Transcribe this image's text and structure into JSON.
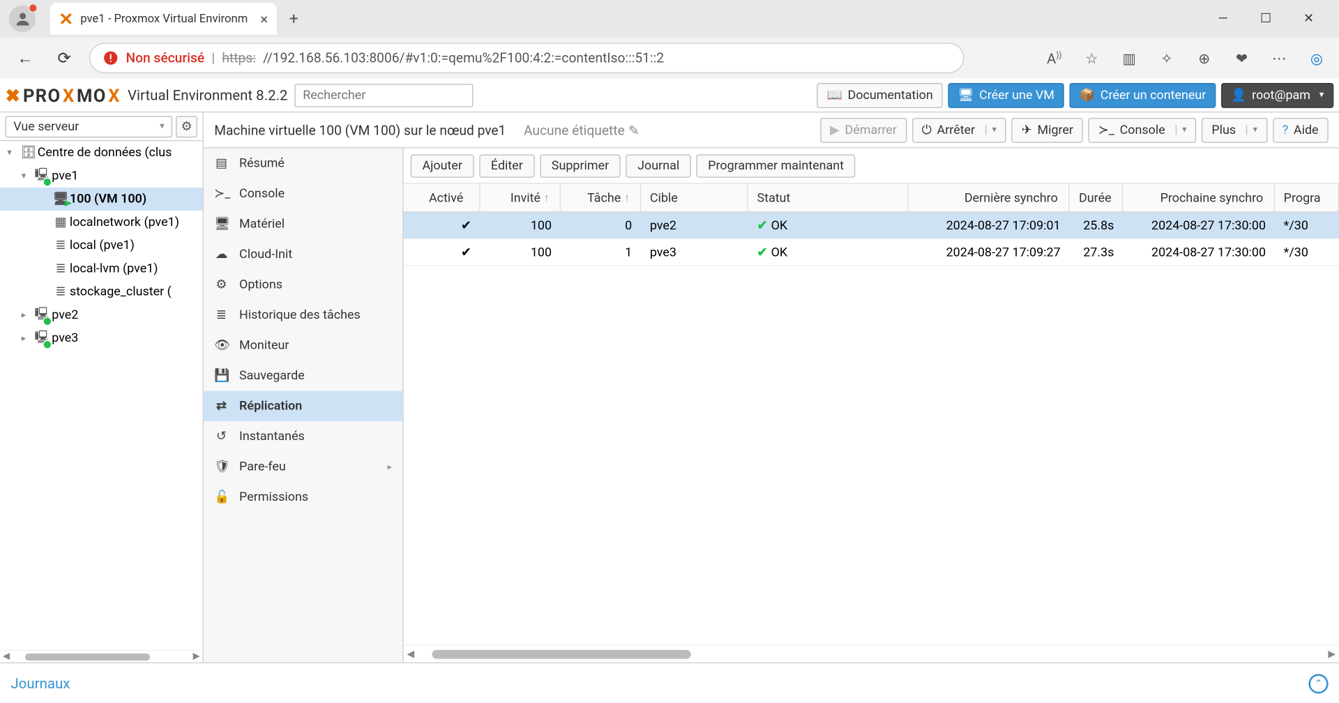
{
  "browser": {
    "tab_title": "pve1 - Proxmox Virtual Environm",
    "not_secure": "Non sécurisé",
    "https_prefix": "https:",
    "url_rest": "//192.168.56.103:8006/#v1:0:=qemu%2F100:4:2:=contentIso:::51::2"
  },
  "header": {
    "suite_name": "PROXMOX",
    "suite_title": "Virtual Environment 8.2.2",
    "search_placeholder": "Rechercher",
    "doc": "Documentation",
    "create_vm": "Créer une VM",
    "create_ct": "Créer un conteneur",
    "user": "root@pam"
  },
  "view_selector": "Vue serveur",
  "tree": {
    "datacenter": "Centre de données (clus",
    "pve1": "pve1",
    "vm100": "100 (VM 100)",
    "localnetwork": "localnetwork (pve1)",
    "local": "local (pve1)",
    "locallvm": "local-lvm (pve1)",
    "stockage": "stockage_cluster (",
    "pve2": "pve2",
    "pve3": "pve3"
  },
  "side_tabs": {
    "resume": "Résumé",
    "console": "Console",
    "hardware": "Matériel",
    "cloudinit": "Cloud-Init",
    "options": "Options",
    "tasks": "Historique des tâches",
    "monitor": "Moniteur",
    "backup": "Sauvegarde",
    "replication": "Réplication",
    "snapshots": "Instantanés",
    "firewall": "Pare-feu",
    "permissions": "Permissions"
  },
  "breadcrumb": {
    "title": "Machine virtuelle 100 (VM 100) sur le nœud pve1",
    "no_tags": "Aucune étiquette"
  },
  "action_bar": {
    "start": "Démarrer",
    "stop": "Arrêter",
    "migrate": "Migrer",
    "console": "Console",
    "more": "Plus",
    "help": "Aide"
  },
  "toolbar": {
    "add": "Ajouter",
    "edit": "Éditer",
    "remove": "Supprimer",
    "log": "Journal",
    "schedule_now": "Programmer maintenant"
  },
  "columns": {
    "enabled": "Activé",
    "guest": "Invité",
    "task": "Tâche",
    "target": "Cible",
    "status": "Statut",
    "last": "Dernière synchro",
    "duration": "Durée",
    "next": "Prochaine synchro",
    "schedule": "Progra"
  },
  "rows": [
    {
      "enabled": "✔",
      "guest": "100",
      "task": "0",
      "target": "pve2",
      "status": "OK",
      "last": "2024-08-27 17:09:01",
      "duration": "25.8s",
      "next": "2024-08-27 17:30:00",
      "schedule": "*/30"
    },
    {
      "enabled": "✔",
      "guest": "100",
      "task": "1",
      "target": "pve3",
      "status": "OK",
      "last": "2024-08-27 17:09:27",
      "duration": "27.3s",
      "next": "2024-08-27 17:30:00",
      "schedule": "*/30"
    }
  ],
  "footer": {
    "log": "Journaux"
  }
}
